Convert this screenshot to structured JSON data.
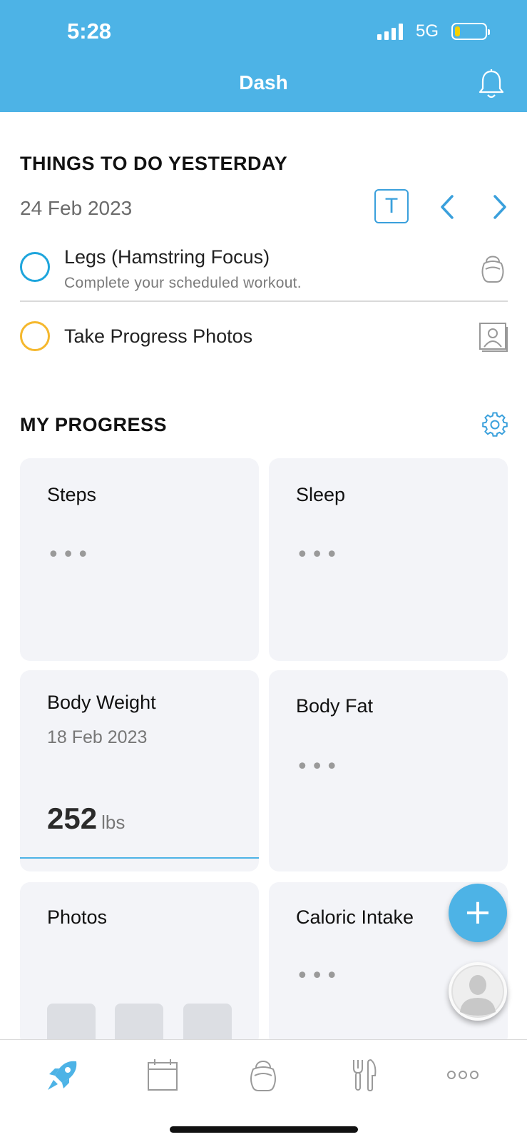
{
  "status_bar": {
    "time": "5:28",
    "network": "5G"
  },
  "header": {
    "title": "Dash"
  },
  "todo": {
    "heading": "THINGS TO DO YESTERDAY",
    "date": "24 Feb 2023",
    "today_button": "T",
    "items": [
      {
        "title": "Legs (Hamstring Focus)",
        "subtitle": "Complete your scheduled workout.",
        "icon": "kettlebell-icon",
        "color": "#1ea5dc"
      },
      {
        "title": "Take Progress Photos",
        "icon": "photo-icon",
        "color": "#f5b82e"
      }
    ]
  },
  "progress": {
    "heading": "MY PROGRESS",
    "cards": {
      "steps": {
        "title": "Steps",
        "placeholder": "•••"
      },
      "sleep": {
        "title": "Sleep",
        "placeholder": "•••"
      },
      "body_weight": {
        "title": "Body Weight",
        "date": "18 Feb 2023",
        "value": "252",
        "unit": "lbs"
      },
      "body_fat": {
        "title": "Body Fat",
        "placeholder": "•••"
      },
      "photos": {
        "title": "Photos"
      },
      "caloric_intake": {
        "title": "Caloric Intake",
        "placeholder": "•••"
      }
    }
  },
  "fab": {
    "label": "+"
  },
  "tabs": [
    "rocket-icon",
    "calendar-icon",
    "kettlebell-icon",
    "fork-knife-icon",
    "more-icon"
  ],
  "colors": {
    "accent": "#4db3e6",
    "card_bg": "#f3f4f8",
    "task_blue": "#1ea5dc",
    "task_yellow": "#f5b82e"
  }
}
